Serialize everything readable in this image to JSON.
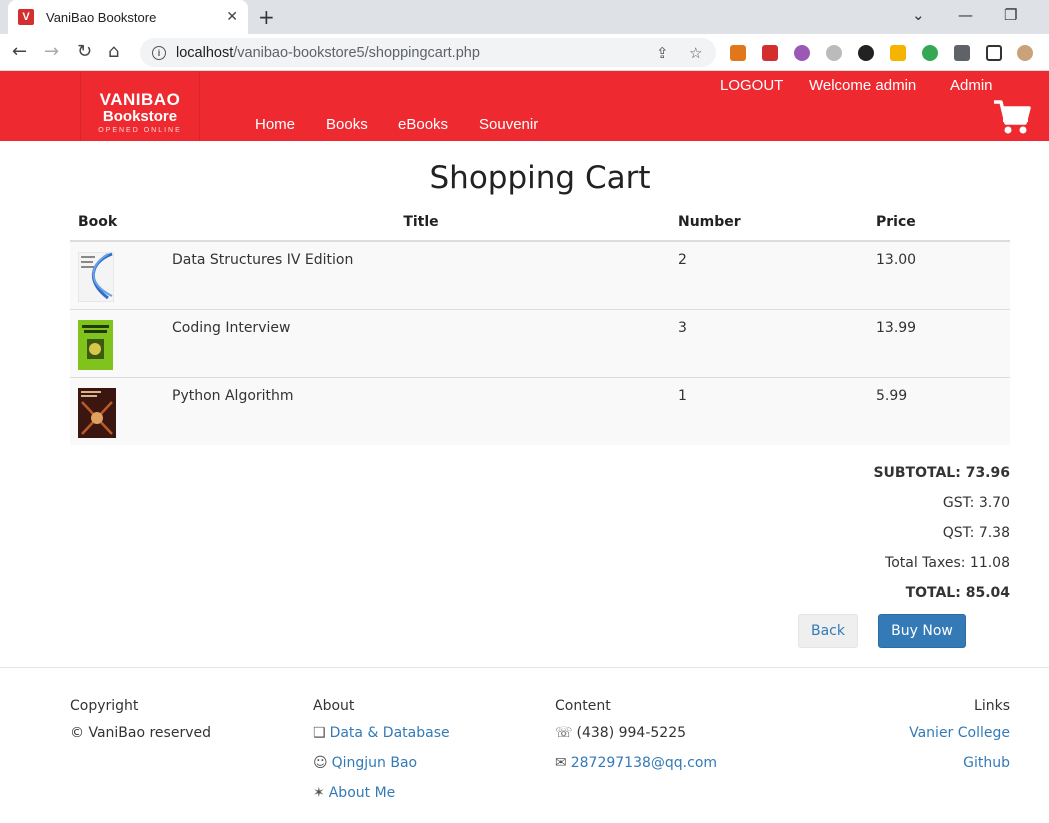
{
  "browser": {
    "tab_title": "VaniBao Bookstore",
    "tab_favicon": "V",
    "url_host": "localhost",
    "url_path": "/vanibao-bookstore5/shoppingcart.php"
  },
  "header": {
    "logo_line1": "VANIBAO",
    "logo_line2": "Bookstore",
    "logo_tagline": "OPENED ONLINE",
    "logout": "LOGOUT",
    "welcome": "Welcome admin",
    "admin": "Admin",
    "nav": [
      "Home",
      "Books",
      "eBooks",
      "Souvenir"
    ]
  },
  "cart": {
    "title": "Shopping Cart",
    "columns": {
      "book": "Book",
      "title": "Title",
      "number": "Number",
      "price": "Price"
    },
    "items": [
      {
        "title": "Data Structures IV Edition",
        "number": "2",
        "price": "13.00"
      },
      {
        "title": "Coding Interview",
        "number": "3",
        "price": "13.99"
      },
      {
        "title": "Python Algorithm",
        "number": "1",
        "price": "5.99"
      }
    ],
    "subtotal": "SUBTOTAL: 73.96",
    "gst": "GST: 3.70",
    "qst": "QST: 7.38",
    "total_taxes": "Total Taxes: 11.08",
    "total": "TOTAL: 85.04",
    "back_label": "Back",
    "buy_label": "Buy Now"
  },
  "footer": {
    "copyright_heading": "Copyright",
    "copyright_text": "© VaniBao reserved",
    "about_heading": "About",
    "about_links": [
      "Data & Database",
      "Qingjun Bao",
      "About Me"
    ],
    "content_heading": "Content",
    "phone": "(438) 994-5225",
    "email": "287297138@qq.com",
    "links_heading": "Links",
    "links": [
      "Vanier College",
      "Github"
    ]
  },
  "colors": {
    "header_red": "#ee2a30",
    "link_blue": "#337ab7"
  }
}
